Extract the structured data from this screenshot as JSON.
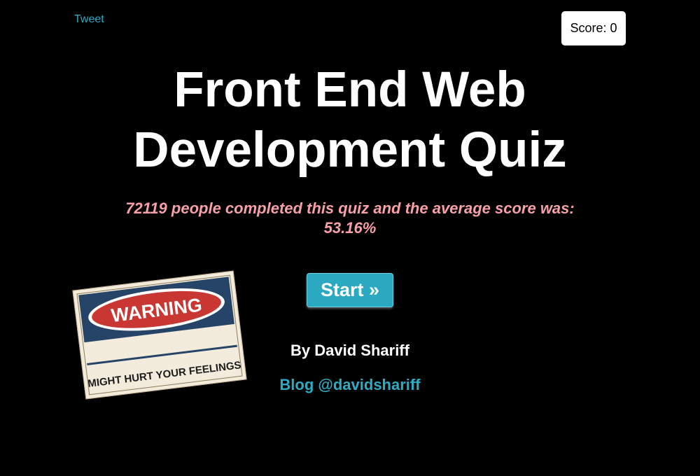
{
  "header": {
    "tweet_label": "Tweet",
    "score_label": "Score: 0"
  },
  "main": {
    "title": "Front End Web Development Quiz",
    "title_line1": "Front End Web",
    "title_line2": "Development Quiz",
    "stats_line1": "72119 people completed this quiz and the average score was:",
    "stats_line2": "53.16%",
    "start_label": "Start »",
    "author": "By David Shariff",
    "blog_link": "Blog @davidshariff"
  },
  "warning_sign": {
    "top_text": "WARNING",
    "bottom_text": "MIGHT HURT YOUR FEELINGS"
  },
  "colors": {
    "background": "#000000",
    "accent": "#2eaac2",
    "stats": "#f7a0a8"
  }
}
